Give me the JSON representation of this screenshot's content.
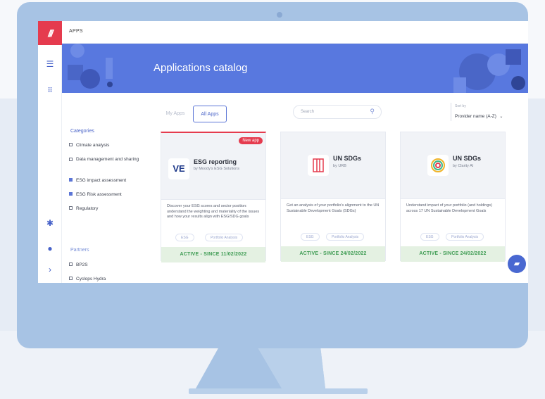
{
  "topbar": {
    "title": "APPS"
  },
  "banner": {
    "title": "Applications catalog"
  },
  "tabs": [
    {
      "label": "My Apps",
      "active": false
    },
    {
      "label": "All Apps",
      "active": true
    }
  ],
  "search": {
    "placeholder": "Search"
  },
  "sort": {
    "label": "Sort by",
    "value": "Provider name (A-Z)"
  },
  "categories": {
    "title": "Categories",
    "items": [
      {
        "label": "Climate analysis",
        "checked": false
      },
      {
        "label": "Data management and sharing",
        "checked": false
      },
      {
        "label": "ESG impact assessment",
        "checked": true
      },
      {
        "label": "ESG Risk assessment",
        "checked": true
      },
      {
        "label": "Regulatory",
        "checked": false
      }
    ]
  },
  "partners": {
    "title": "Partners",
    "items": [
      {
        "label": "BP2S",
        "checked": false
      },
      {
        "label": "Cyclops Hydra",
        "checked": false
      }
    ]
  },
  "cards": [
    {
      "badge": "New app",
      "logo": "VE",
      "name": "ESG reporting",
      "by": "by Moody's ESG Solutions",
      "description": "Discover your ESG scores and sector position: understand the weighting and materiality of the issues and how your results align with ESG/SDG goals",
      "tags": [
        "ESG",
        "Portfolio Analysis"
      ],
      "status": "ACTIVE - SINCE 11/02/2022"
    },
    {
      "logo": "building-logo",
      "name": "UN SDGs",
      "by": "by URB",
      "description": "Get an analysis of your portfolio's alignment to the UN Sustainable Development Goals (SDGs)",
      "tags": [
        "ESG",
        "Portfolio Analysis"
      ],
      "status": "ACTIVE - SINCE 24/02/2022"
    },
    {
      "logo": "rings-logo",
      "name": "UN SDGs",
      "by": "by Clarity AI",
      "description": "Understand impact of your portfolio (and holdings) across 17 UN Sustainable Development Goals",
      "tags": [
        "ESG",
        "Portfolio Analysis"
      ],
      "status": "ACTIVE - SINCE 24/02/2022"
    }
  ],
  "colors": {
    "brand_red": "#e53b4e",
    "accent_blue": "#5878df",
    "active_green": "#3d9b52",
    "monitor": "#a7c3e4"
  },
  "icons": [
    "menu-icon",
    "grid-icon",
    "settings-icon",
    "user-icon",
    "chevron-right-icon",
    "search-icon",
    "chat-icon"
  ]
}
